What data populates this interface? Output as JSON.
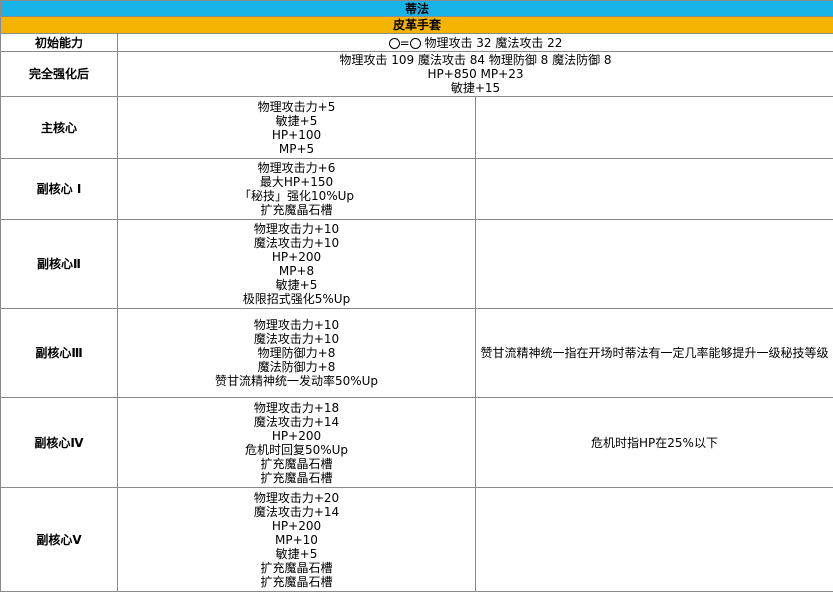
{
  "title": "蒂法",
  "item_name": "皮革手套",
  "initial": {
    "label": "初始能力",
    "eq": "=",
    "stats": "物理攻击 32 魔法攻击 22"
  },
  "full": {
    "label": "完全强化后",
    "lines": [
      "物理攻击 109 魔法攻击 84 物理防御 8 魔法防御 8",
      "HP+850 MP+23",
      "敏捷+15"
    ]
  },
  "rows": [
    {
      "label": "主核心",
      "lines": [
        "物理攻击力+5",
        "敏捷+5",
        "HP+100",
        "MP+5"
      ],
      "note": ""
    },
    {
      "label": "副核心 Ⅰ",
      "lines": [
        "物理攻击力+6",
        "最大HP+150",
        "「秘技」强化10%Up",
        "扩充魔晶石槽"
      ],
      "note": ""
    },
    {
      "label": "副核心Ⅱ",
      "lines": [
        "物理攻击力+10",
        "魔法攻击力+10",
        "HP+200",
        "MP+8",
        "敏捷+5",
        "极限招式强化5%Up"
      ],
      "note": ""
    },
    {
      "label": "副核心Ⅲ",
      "lines": [
        "物理攻击力+10",
        "魔法攻击力+10",
        "物理防御力+8",
        "魔法防御力+8",
        "赞甘流精神统一发动率50%Up"
      ],
      "note": "赞甘流精神统一指在开场时蒂法有一定几率能够提升一级秘技等级"
    },
    {
      "label": "副核心Ⅳ",
      "lines": [
        "物理攻击力+18",
        "魔法攻击力+14",
        "HP+200",
        "危机时回复50%Up",
        "扩充魔晶石槽",
        "扩充魔晶石槽"
      ],
      "note": "危机时指HP在25%以下"
    },
    {
      "label": "副核心Ⅴ",
      "lines": [
        "物理攻击力+20",
        "魔法攻击力+14",
        "HP+200",
        "MP+10",
        "敏捷+5",
        "扩充魔晶石槽",
        "扩充魔晶石槽"
      ],
      "note": ""
    }
  ]
}
